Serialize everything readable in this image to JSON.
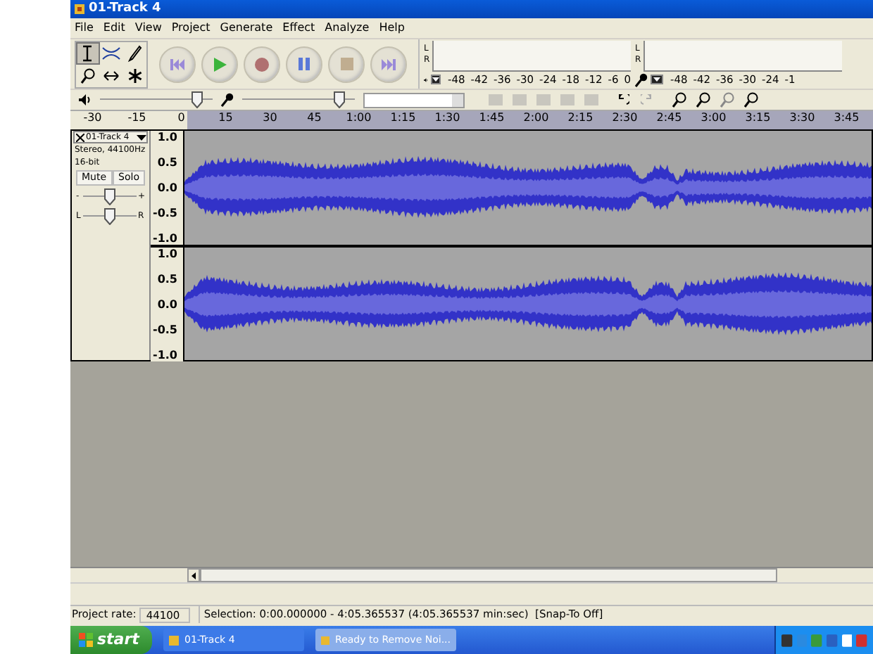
{
  "window": {
    "title": "01-Track 4"
  },
  "menu": [
    "File",
    "Edit",
    "View",
    "Project",
    "Generate",
    "Effect",
    "Analyze",
    "Help"
  ],
  "tools": [
    {
      "kind": "select",
      "selected": true
    },
    {
      "kind": "envelope",
      "selected": false
    },
    {
      "kind": "draw",
      "selected": false
    },
    {
      "kind": "zoom",
      "selected": false
    },
    {
      "kind": "timeshift",
      "selected": false
    },
    {
      "kind": "multi",
      "selected": false
    }
  ],
  "transport": [
    {
      "kind": "skip-start"
    },
    {
      "kind": "play"
    },
    {
      "kind": "record"
    },
    {
      "kind": "pause"
    },
    {
      "kind": "stop"
    },
    {
      "kind": "skip-end"
    }
  ],
  "meters": [
    {
      "kind": "playback",
      "channels": [
        "L",
        "R"
      ],
      "scale": [
        "-48",
        "-42",
        "-36",
        "-30",
        "-24",
        "-18",
        "-12",
        "-6",
        "0"
      ]
    },
    {
      "kind": "record",
      "channels": [
        "L",
        "R"
      ],
      "scale": [
        "-48",
        "-42",
        "-36",
        "-30",
        "-24",
        "-1"
      ]
    }
  ],
  "mixer": [
    {
      "kind": "playback",
      "level": 0.9
    },
    {
      "kind": "record",
      "level": 0.9
    }
  ],
  "ruler": [
    "-30",
    "-15",
    "0",
    "15",
    "30",
    "45",
    "1:00",
    "1:15",
    "1:30",
    "1:45",
    "2:00",
    "2:15",
    "2:30",
    "2:45",
    "3:00",
    "3:15",
    "3:30",
    "3:45"
  ],
  "track": {
    "name": "01-Track 4",
    "info": [
      "Stereo, 44100Hz",
      "16-bit"
    ],
    "buttons": [
      "Mute",
      "Solo"
    ],
    "gain": {
      "min_label": "-",
      "max_label": "+",
      "level": 0.5
    },
    "pan": {
      "min_label": "L",
      "max_label": "R",
      "level": 0.5
    },
    "channels": [
      {
        "axis": [
          "1.0",
          "0.5",
          "0.0",
          "-0.5",
          "-1.0"
        ]
      },
      {
        "axis": [
          "1.0",
          "0.5",
          "0.0",
          "-0.5",
          "-1.0"
        ]
      }
    ]
  },
  "status_bar": {
    "rate_label": "Project rate:",
    "rate": "44100",
    "selection": "Selection: 0:00.000000 - 4:05.365537 (4:05.365537 min:sec)  [Snap-To Off]"
  },
  "taskbar": {
    "start": "start",
    "tasks": [
      {
        "label": "01-Track 4",
        "selected": false
      },
      {
        "label": "Ready to Remove Noi...",
        "selected": true
      }
    ]
  }
}
